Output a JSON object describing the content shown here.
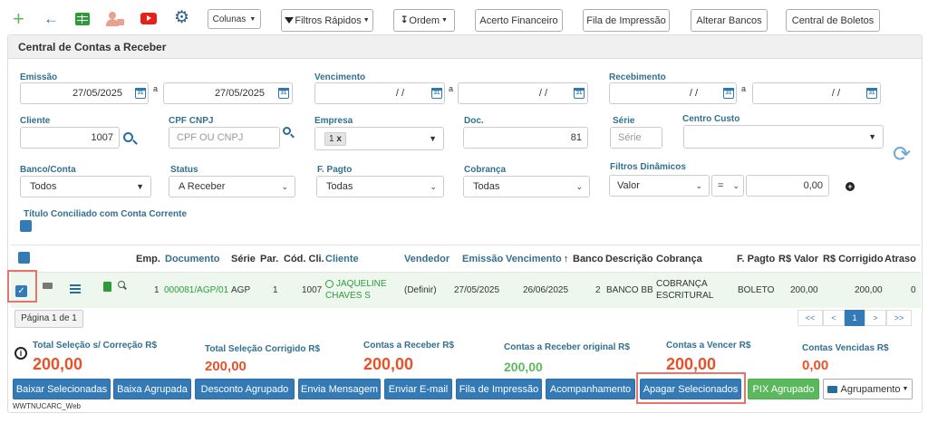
{
  "toolbar": {
    "colunas": "Colunas",
    "filtros_rapidos": "Filtros Rápidos",
    "ordem": "Ordem",
    "acerto_financeiro": "Acerto Financeiro",
    "fila_impressao": "Fila de Impressão",
    "alterar_bancos": "Alterar Bancos",
    "central_boletos": "Central de Boletos"
  },
  "panel": {
    "title": "Central de Contas a Receber"
  },
  "filters": {
    "emissao": {
      "label": "Emissão",
      "from": "27/05/2025",
      "a": "a",
      "to": "27/05/2025"
    },
    "vencimento": {
      "label": "Vencimento",
      "from": "/ /",
      "a": "a",
      "to": "/ /"
    },
    "recebimento": {
      "label": "Recebimento",
      "from": "/ /",
      "a": "a",
      "to": "/ /"
    },
    "cliente": {
      "label": "Cliente",
      "value": "1007"
    },
    "cpf_cnpj": {
      "label": "CPF CNPJ",
      "placeholder": "CPF OU CNPJ"
    },
    "empresa": {
      "label": "Empresa",
      "tag": "1",
      "tag_remove": "x"
    },
    "doc": {
      "label": "Doc.",
      "value": "81"
    },
    "serie": {
      "label": "Série",
      "placeholder": "Série"
    },
    "centro_custo": {
      "label": "Centro Custo",
      "value": ""
    },
    "banco_conta": {
      "label": "Banco/Conta",
      "value": "Todos"
    },
    "status": {
      "label": "Status",
      "value": "A Receber"
    },
    "f_pagto": {
      "label": "F. Pagto",
      "value": "Todas"
    },
    "cobranca": {
      "label": "Cobrança",
      "value": "Todas"
    },
    "filtros_dinamicos": {
      "label": "Filtros Dinâmicos",
      "field": "Valor",
      "op": "=",
      "value": "0,00"
    },
    "titulo_conciliado": {
      "label": "Título Conciliado com Conta Corrente"
    }
  },
  "table": {
    "headers": [
      "Emp.",
      "Documento",
      "Série",
      "Par.",
      "Cód. Cli.",
      "Cliente",
      "Vendedor",
      "Emissão",
      "Vencimento",
      "Banco",
      "Descrição",
      "Cobrança",
      "F. Pagto",
      "R$ Valor",
      "R$ Corrigido",
      "Atraso"
    ],
    "sort_arrow": "↑",
    "row": {
      "emp": "1",
      "documento": "000081/AGP/01",
      "serie": "AGP",
      "par": "1",
      "cod_cli": "1007",
      "cliente_line1": "JAQUELINE",
      "cliente_line2": "CHAVES S",
      "vendedor": "(Definir)",
      "emissao": "27/05/2025",
      "vencimento": "26/06/2025",
      "banco": "2",
      "descricao": "BANCO BB",
      "cobranca_line1": "COBRANÇA",
      "cobranca_line2": "ESCRITURAL",
      "f_pagto": "BOLETO",
      "valor": "200,00",
      "corrigido": "200,00",
      "atraso": "0"
    }
  },
  "pagination": {
    "page_info": "Página 1 de 1",
    "first": "<<",
    "prev": "<",
    "current": "1",
    "next": ">",
    "last": ">>"
  },
  "totals": {
    "sel_correcao": {
      "label": "Total Seleção s/ Correção R$",
      "value": "200,00"
    },
    "sel_corrigido": {
      "label": "Total Seleção Corrigido R$",
      "value": "200,00"
    },
    "a_receber": {
      "label": "Contas a Receber R$",
      "value": "200,00"
    },
    "a_receber_original": {
      "label": "Contas a Receber original R$",
      "value": "200,00"
    },
    "a_vencer": {
      "label": "Contas a Vencer R$",
      "value": "200,00"
    },
    "vencidas": {
      "label": "Contas Vencidas R$",
      "value": "0,00"
    }
  },
  "actions": {
    "baixar_selecionadas": "Baixar Selecionadas",
    "baixa_agrupada": "Baixa Agrupada",
    "desconto_agrupado": "Desconto Agrupado",
    "envia_mensagem": "Envia Mensagem",
    "enviar_email": "Enviar E-mail",
    "fila_impressao": "Fila de Impressão",
    "acompanhamento": "Acompanhamento",
    "apagar_selecionados": "Apagar Selecionados",
    "pix_agrupado": "PIX Agrupado",
    "agrupamento": "Agrupamento"
  },
  "footer": {
    "code": "WWTNUCARC_Web"
  },
  "colors": {
    "accent": "#337ab7",
    "label": "#31708f",
    "link": "#2e9a3a",
    "total": "#e8512a",
    "total_green": "#5cb85c",
    "highlight": "#e8736a"
  }
}
